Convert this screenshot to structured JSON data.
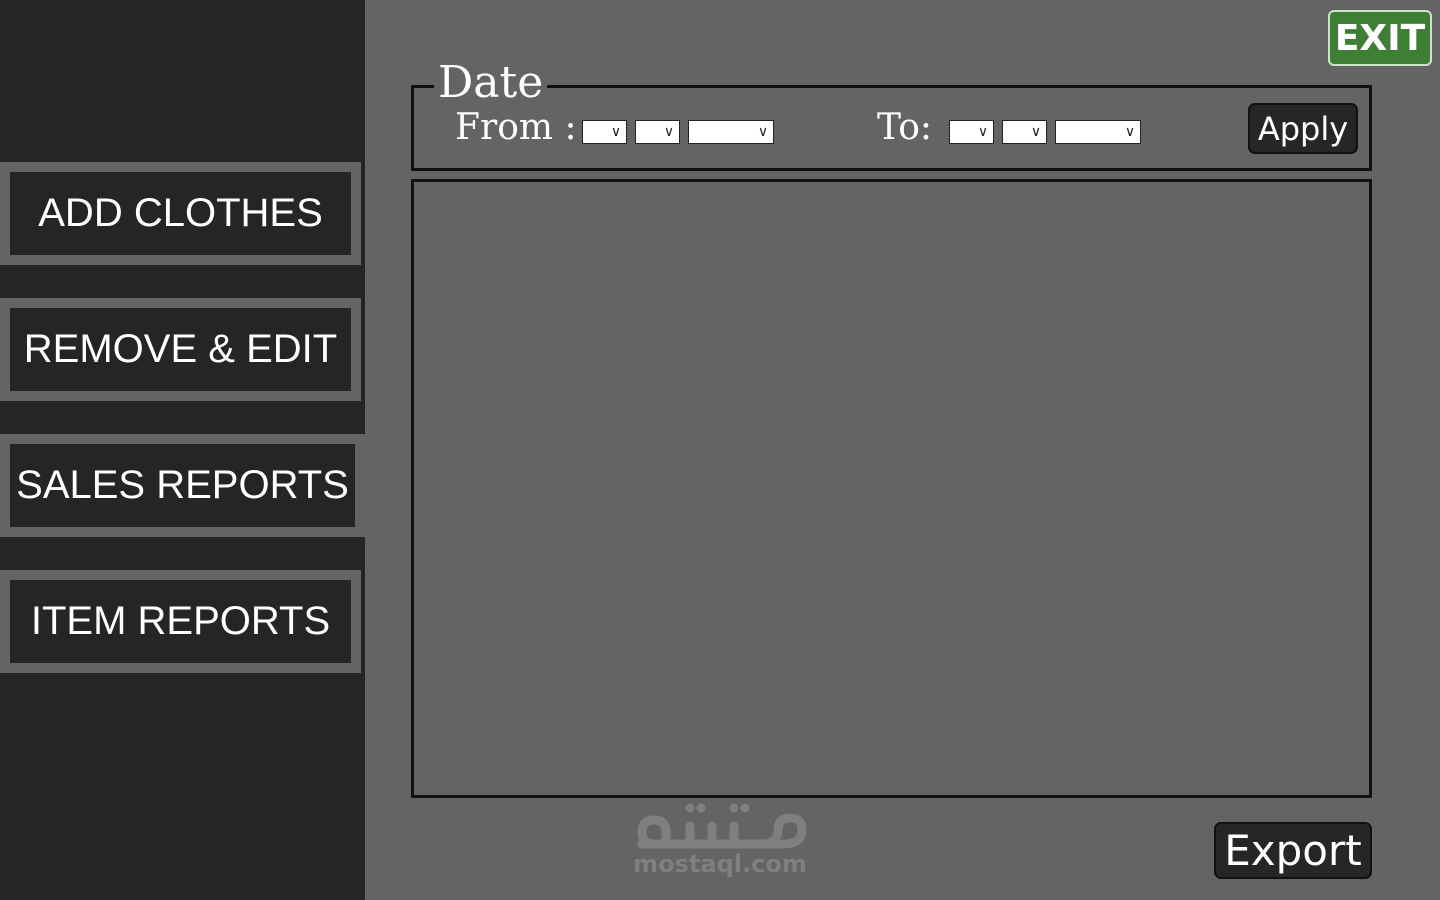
{
  "sidebar": {
    "items": [
      {
        "label": "ADD CLOTHES"
      },
      {
        "label": "REMOVE & EDIT"
      },
      {
        "label": "SALES REPORTS"
      },
      {
        "label": "ITEM REPORTS"
      }
    ]
  },
  "header": {
    "exit_label": "EXIT"
  },
  "date_filter": {
    "legend": "Date",
    "from_label": "From :",
    "to_label": "To:",
    "dropdown_arrow": "∨",
    "apply_label": "Apply"
  },
  "footer": {
    "export_label": "Export"
  },
  "watermark": {
    "text": "mostaql.com"
  },
  "colors": {
    "sidebar_bg": "#252525",
    "page_bg": "#646464",
    "exit_bg": "#3f7f35",
    "button_bg": "#262626"
  }
}
